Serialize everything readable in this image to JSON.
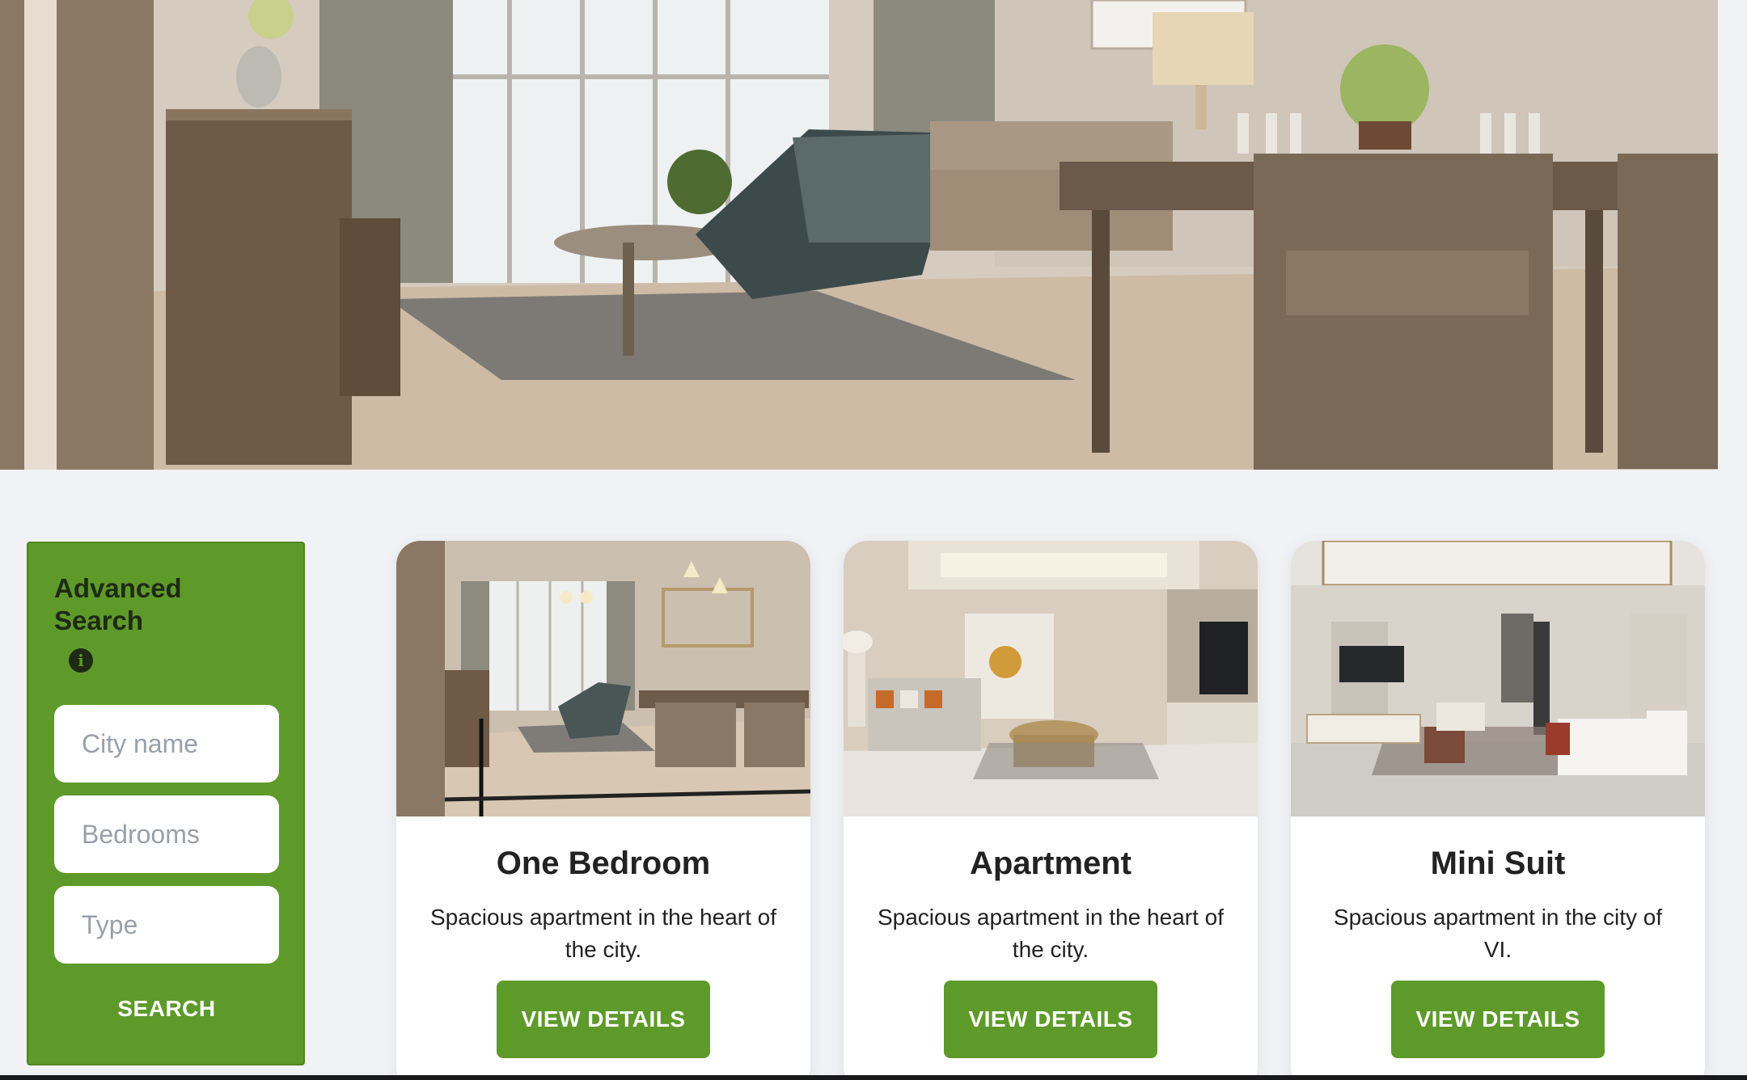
{
  "hero": {
    "image": "living-room-dining-photo"
  },
  "search": {
    "title": "Advanced Search",
    "info_icon": "info-icon",
    "city_placeholder": "City name",
    "bedrooms_placeholder": "Bedrooms",
    "type_placeholder": "Type",
    "button_label": "SEARCH"
  },
  "listings": [
    {
      "image": "bedroom-living-photo",
      "title": "One Bedroom",
      "description": "Spacious apartment in the heart of the city.",
      "button_label": "VIEW DETAILS"
    },
    {
      "image": "apartment-living-photo",
      "title": "Apartment",
      "description": "Spacious apartment in the heart of the city.",
      "button_label": "VIEW DETAILS"
    },
    {
      "image": "mini-suite-living-photo",
      "title": "Mini Suit",
      "description": "Spacious apartment in the city of VI.",
      "button_label": "VIEW DETAILS"
    }
  ],
  "colors": {
    "accent": "#5e9a2a",
    "background": "#f0f2f5",
    "card": "#ffffff",
    "text": "#222222"
  }
}
